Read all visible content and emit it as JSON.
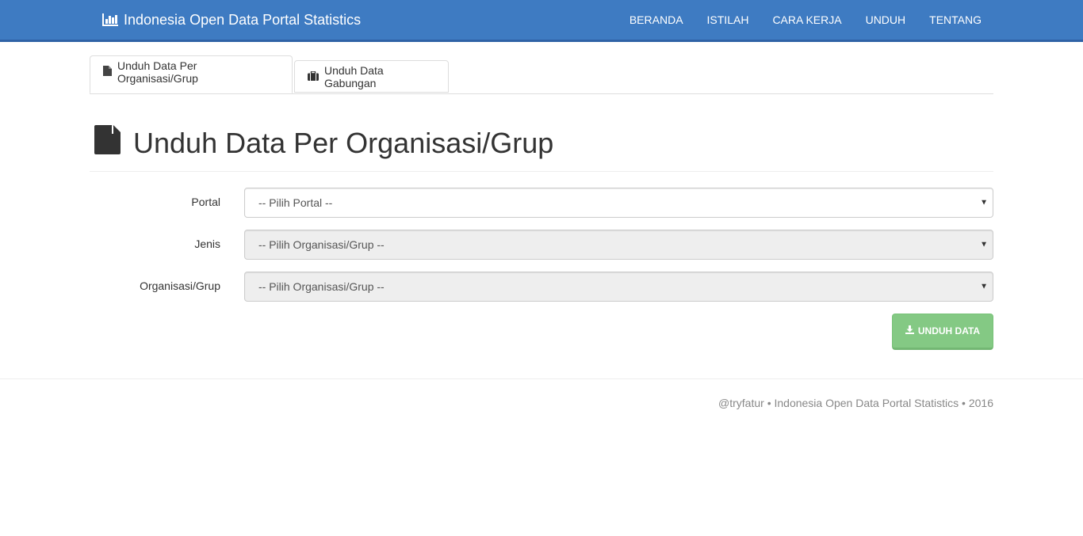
{
  "navbar": {
    "brand": "Indonesia Open Data Portal Statistics",
    "brand_icon": "bar-chart-icon",
    "links": [
      "BERANDA",
      "ISTILAH",
      "CARA KERJA",
      "UNDUH",
      "TENTANG"
    ],
    "background_color": "#3e7bc2"
  },
  "tabs": [
    {
      "label": "Unduh Data Per Organisasi/Grup",
      "icon": "file-icon",
      "active": true
    },
    {
      "label": "Unduh Data Gabungan",
      "icon": "briefcase-icon",
      "active": false
    }
  ],
  "page": {
    "title": "Unduh Data Per Organisasi/Grup",
    "title_icon": "file-icon"
  },
  "form": {
    "portal": {
      "label": "Portal",
      "value": "-- Pilih Portal --"
    },
    "jenis": {
      "label": "Jenis",
      "value": "-- Pilih Organisasi/Grup --",
      "disabled": true
    },
    "organisasi": {
      "label": "Organisasi/Grup",
      "value": "-- Pilih Organisasi/Grup --",
      "disabled": true
    },
    "submit_label": "UNDUH DATA",
    "submit_icon": "download-icon",
    "submit_color": "#5cb85c"
  },
  "footer": {
    "text": "@tryfatur • Indonesia Open Data Portal Statistics • 2016"
  }
}
